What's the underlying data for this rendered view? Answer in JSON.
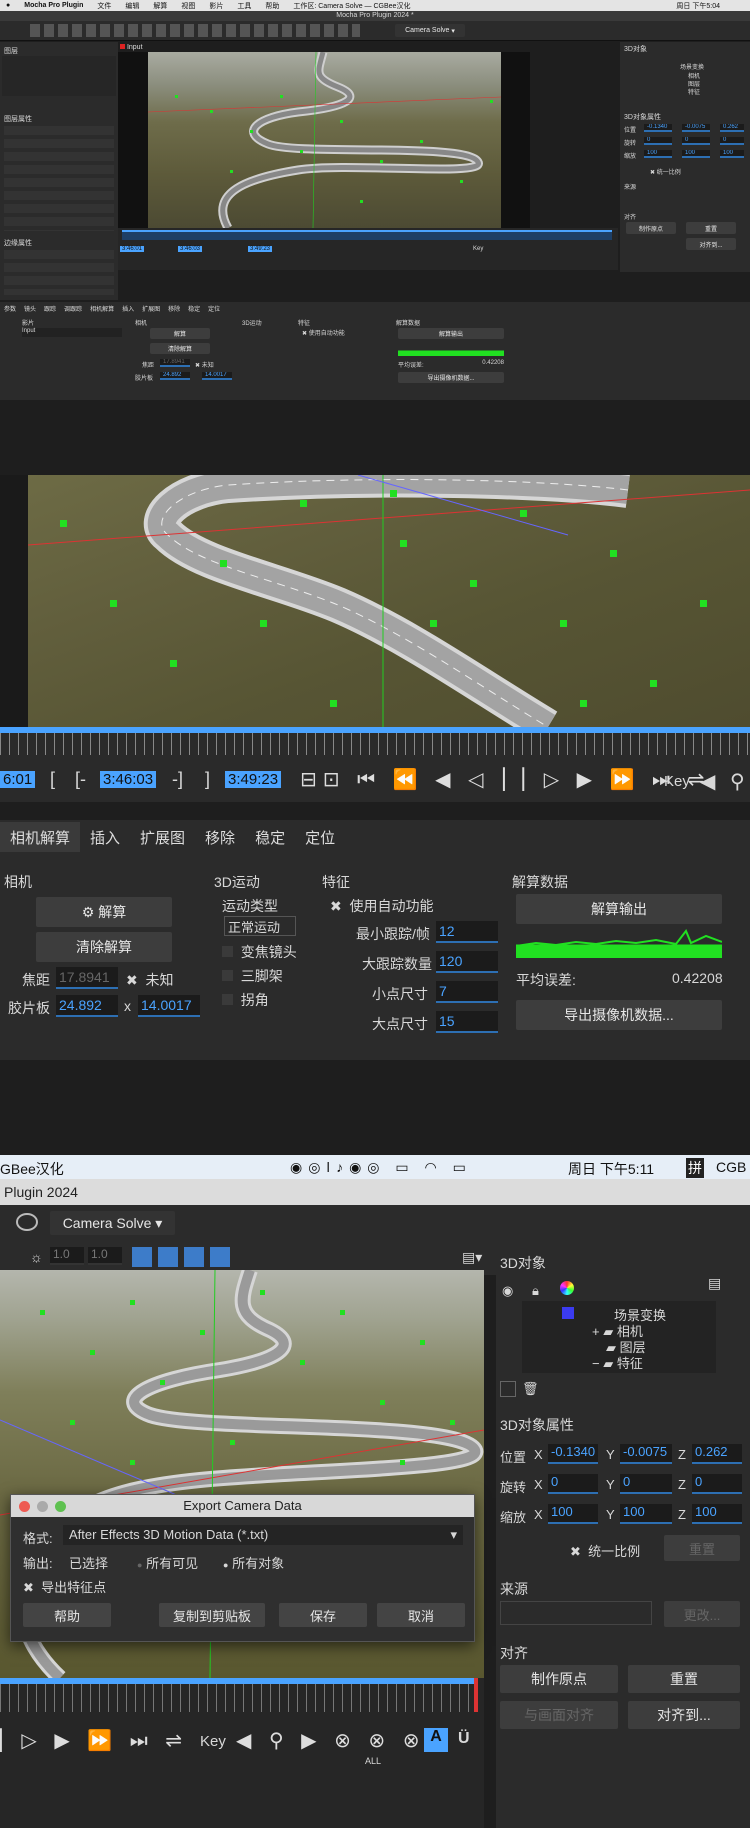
{
  "top_menubar": {
    "apple": "",
    "app": "Mocha Pro Plugin",
    "menus": [
      "文件",
      "编辑",
      "解算",
      "视图",
      "影片",
      "工具",
      "帮助"
    ],
    "workspace": "工作区: Camera Solve — CGBee汉化",
    "time": "周日 下午5:04"
  },
  "window_title": "Mocha Pro Plugin 2024 *",
  "top_toolbar": {
    "view_mode": "Camera Solve"
  },
  "left_panel": {
    "layers_title": "图层",
    "layer_name": "Input",
    "layer_props_title": "图层属性",
    "edge_props_title": "边缘属性"
  },
  "right_panel_small": {
    "title": "3D对象",
    "tree": [
      "场景变换",
      "相机",
      "图层",
      "特征"
    ],
    "props_title": "3D对象属性",
    "pos": {
      "label": "位置",
      "x": "-0.1340",
      "y": "-0.0075",
      "z": "0.262"
    },
    "rot": {
      "label": "旋转",
      "x": "0",
      "y": "0",
      "z": "0"
    },
    "scale": {
      "label": "缩放",
      "x": "100",
      "y": "100",
      "z": "100"
    },
    "uniform": "统一比例",
    "source": "来源",
    "align": "对齐",
    "make_origin": "制作原点",
    "reset": "重置",
    "align_to": "对齐到..."
  },
  "small_timeline": {
    "t1": "3:46:01",
    "t2": "3:46:03",
    "t3": "3:49:23",
    "key": "Key"
  },
  "small_params": {
    "tabs": [
      "参数",
      "镜头",
      "跟踪",
      "调跟踪",
      "相机解算",
      "插入",
      "扩展图",
      "移除",
      "稳定",
      "定位"
    ],
    "clip_label": "影片",
    "clip_value": "Input",
    "camera": "相机",
    "solve": "解算",
    "clear": "清除解算",
    "focal": "焦距",
    "focal_val": "17.8941",
    "unknown": "未知",
    "film": "胶片板",
    "film_x": "24.892",
    "film_y": "14.0017",
    "motion3d": "3D运动",
    "motion_type": "运动类型",
    "motion_val": "正常运动",
    "zoom": "变焦镜头",
    "tripod": "三脚架",
    "corner": "拐角",
    "features": "特征",
    "auto": "使用自动功能",
    "min_track": "最小跟踪/帧",
    "min_track_val": "12",
    "max_track": "大跟踪数量",
    "max_track_val": "120",
    "small_pt": "小点尺寸",
    "small_pt_val": "7",
    "big_pt": "大点尺寸",
    "big_pt_val": "15",
    "solve_data": "解算数据",
    "solve_output": "解算输出",
    "avg_err": "平均误差:",
    "avg_err_val": "0.42208",
    "export": "导出摄像机数据..."
  },
  "zoom_timeline": {
    "t1": "6:01",
    "t2": "3:46:03",
    "t3": "3:49:23",
    "key": "Key",
    "bracket_open": "[",
    "bracket_open2": "[-",
    "bracket_close": "-]",
    "bracket_close2": "]"
  },
  "zoom_params": {
    "tabs": [
      "相机解算",
      "插入",
      "扩展图",
      "移除",
      "稳定",
      "定位"
    ],
    "camera": "相机",
    "solve": "解算",
    "clear": "清除解算",
    "focal": "焦距",
    "focal_val": "17.8941",
    "unknown": "未知",
    "film": "胶片板",
    "film_x": "24.892",
    "film_sep": "x",
    "film_y": "14.0017",
    "motion3d": "3D运动",
    "motion_type": "运动类型",
    "motion_val": "正常运动",
    "zoom": "变焦镜头",
    "tripod": "三脚架",
    "corner": "拐角",
    "features": "特征",
    "auto": "使用自动功能",
    "min_track": "最小跟踪/帧",
    "min_track_val": "12",
    "max_track": "大跟踪数量",
    "max_track_val": "120",
    "small_pt": "小点尺寸",
    "small_pt_val": "7",
    "big_pt": "大点尺寸",
    "big_pt_val": "15",
    "solve_data": "解算数据",
    "solve_output": "解算输出",
    "avg_err": "平均误差:",
    "avg_err_val": "0.42208",
    "export": "导出摄像机数据..."
  },
  "bottom_menubar": {
    "left": "GBee汉化",
    "time": "周日 下午5:11",
    "right": "CGB",
    "input_method": "拼"
  },
  "bottom_window": {
    "title": "Plugin 2024",
    "view_mode": "Camera Solve",
    "fields": [
      "1.0",
      "1.0"
    ]
  },
  "bottom_right": {
    "title": "3D对象",
    "tree": [
      "场景变换",
      "相机",
      "图层",
      "特征"
    ],
    "props_title": "3D对象属性",
    "pos": {
      "label": "位置",
      "x": "-0.1340",
      "y": "-0.0075",
      "z": "0.262"
    },
    "rot": {
      "label": "旋转",
      "x": "0",
      "y": "0",
      "z": "0"
    },
    "scale": {
      "label": "缩放",
      "x": "100",
      "y": "100",
      "z": "100"
    },
    "uniform": "统一比例",
    "reset_btn": "重置",
    "source": "来源",
    "change": "更改...",
    "align": "对齐",
    "make_origin": "制作原点",
    "reset": "重置",
    "align_view": "与画面对齐",
    "align_to": "对齐到..."
  },
  "dialog": {
    "title": "Export Camera Data",
    "format_label": "格式:",
    "format_value": "After Effects 3D Motion Data (*.txt)",
    "output_label": "输出:",
    "opt_selected": "已选择",
    "opt_visible": "所有可见",
    "opt_all": "所有对象",
    "export_features": "导出特征点",
    "help": "帮助",
    "copy": "复制到剪贴板",
    "save": "保存",
    "cancel": "取消"
  },
  "bottom_timeline": {
    "key": "Key",
    "all": "ALL"
  },
  "chart_colors": {
    "accent": "#4aa3ff",
    "track": "#21e021",
    "panel": "#2b2b2b"
  }
}
